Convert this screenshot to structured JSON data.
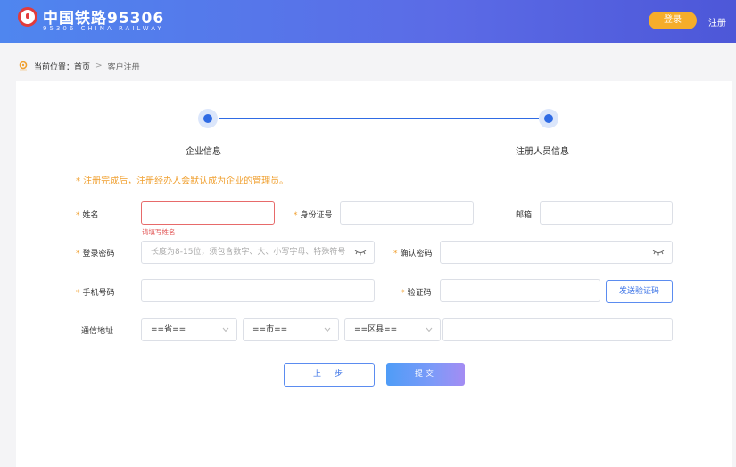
{
  "header": {
    "brand": "中国铁路95306",
    "brand_sub": "95306 CHINA RAILWAY",
    "login": "登录",
    "register": "注册"
  },
  "breadcrumb": {
    "prefix": "当前位置：",
    "home": "首页",
    "separator": ">",
    "current": "客户注册"
  },
  "steps": [
    {
      "label": "企业信息"
    },
    {
      "label": "注册人员信息"
    }
  ],
  "notice": "* 注册完成后，注册经办人会默认成为企业的管理员。",
  "form": {
    "name": {
      "label": "姓名",
      "required": "*",
      "value": "",
      "error": "请填写姓名"
    },
    "id_number": {
      "label": "身份证号",
      "required": "*",
      "value": ""
    },
    "email": {
      "label": "邮箱",
      "value": ""
    },
    "password": {
      "label": "登录密码",
      "required": "*",
      "placeholder": "长度为8-15位，须包含数字、大、小写字母、特殊符号"
    },
    "confirm_password": {
      "label": "确认密码",
      "required": "*",
      "value": ""
    },
    "phone": {
      "label": "手机号码",
      "required": "*",
      "value": ""
    },
    "code": {
      "label": "验证码",
      "required": "*",
      "value": "",
      "button": "发送验证码"
    },
    "address": {
      "label": "通信地址",
      "province": "==省==",
      "city": "==市==",
      "district": "==区县==",
      "detail": ""
    }
  },
  "actions": {
    "prev": "上一步",
    "submit": "提交"
  },
  "colors": {
    "header_gradient_start": "#4f86ef",
    "accent": "#2f6be4",
    "login_bg": "#f6ad2a",
    "required": "#f0a030",
    "error": "#e25757"
  }
}
